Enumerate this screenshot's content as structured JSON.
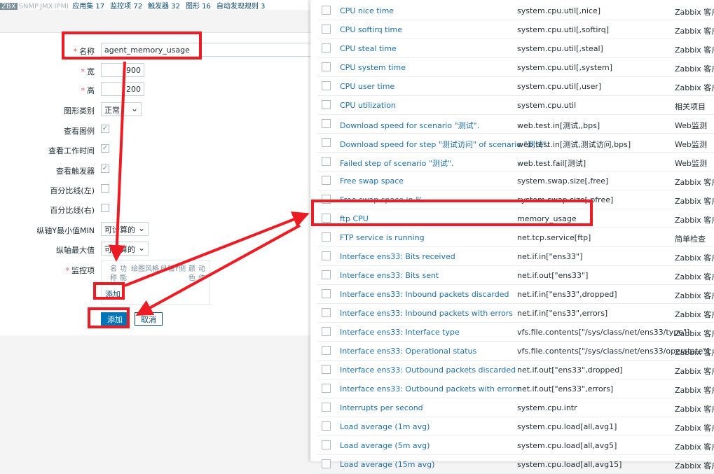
{
  "topbar": {
    "tags": [
      "ZBX",
      "SNMP",
      "JMX",
      "IPMI"
    ],
    "links": [
      "应用集 17",
      "监控项 72",
      "触发器 32",
      "图形 16",
      "自动发现规则 3"
    ]
  },
  "form": {
    "name": {
      "label": "名称",
      "value": "agent_memory_usage"
    },
    "width": {
      "label": "宽",
      "value": "900"
    },
    "height": {
      "label": "高",
      "value": "200"
    },
    "graph_type": {
      "label": "图形类别",
      "value": "正常"
    },
    "show_legend": {
      "label": "查看图例"
    },
    "show_working_time": {
      "label": "查看工作时间"
    },
    "show_triggers": {
      "label": "查看触发器"
    },
    "percentile_left": {
      "label": "百分比线(左)"
    },
    "percentile_right": {
      "label": "百分比线(右)"
    },
    "ymin": {
      "label": "纵轴Y最小值MIN",
      "value": "可计算的"
    },
    "ymax": {
      "label": "纵轴最大值",
      "value": "可计算的"
    },
    "items": {
      "label": "监控项",
      "columns": [
        "名称",
        "功能",
        "绘图风格",
        "纵轴Y侧",
        "颜色",
        "动作"
      ],
      "add_link": "添加"
    },
    "buttons": {
      "add": "添加",
      "cancel": "取消"
    }
  },
  "popup": {
    "rows": [
      {
        "name": "CPU nice time",
        "key": "system.cpu.util[,nice]",
        "type": "Zabbix 客户端"
      },
      {
        "name": "CPU softirq time",
        "key": "system.cpu.util[,softirq]",
        "type": "Zabbix 客户端"
      },
      {
        "name": "CPU steal time",
        "key": "system.cpu.util[,steal]",
        "type": "Zabbix 客户端"
      },
      {
        "name": "CPU system time",
        "key": "system.cpu.util[,system]",
        "type": "Zabbix 客户端"
      },
      {
        "name": "CPU user time",
        "key": "system.cpu.util[,user]",
        "type": "Zabbix 客户端"
      },
      {
        "name": "CPU utilization",
        "key": "system.cpu.util",
        "type": "相关项目"
      },
      {
        "name": "Download speed for scenario \"测试\".",
        "key": "web.test.in[测试,,bps]",
        "type": "Web监测"
      },
      {
        "name": "Download speed for step \"测试访问\" of scenario \"测试\".",
        "key": "web.test.in[测试,测试访问,bps]",
        "type": "Web监测"
      },
      {
        "name": "Failed step of scenario \"测试\".",
        "key": "web.test.fail[测试]",
        "type": "Web监测"
      },
      {
        "name": "Free swap space",
        "key": "system.swap.size[,free]",
        "type": "Zabbix 客户端"
      },
      {
        "name": "Free swap space in %",
        "key": "system.swap.size[,pfree]",
        "type": "Zabbix 客户端"
      },
      {
        "name": "ftp CPU",
        "key": "memory_usage",
        "type": "Zabbix 客户端"
      },
      {
        "name": "FTP service is running",
        "key": "net.tcp.service[ftp]",
        "type": "简单检查"
      },
      {
        "name": "Interface ens33: Bits received",
        "key": "net.if.in[\"ens33\"]",
        "type": "Zabbix 客户端"
      },
      {
        "name": "Interface ens33: Bits sent",
        "key": "net.if.out[\"ens33\"]",
        "type": "Zabbix 客户端"
      },
      {
        "name": "Interface ens33: Inbound packets discarded",
        "key": "net.if.in[\"ens33\",dropped]",
        "type": "Zabbix 客户端"
      },
      {
        "name": "Interface ens33: Inbound packets with errors",
        "key": "net.if.in[\"ens33\",errors]",
        "type": "Zabbix 客户端"
      },
      {
        "name": "Interface ens33: Interface type",
        "key": "vfs.file.contents[\"/sys/class/net/ens33/type\"]",
        "type": "Zabbix 客户端"
      },
      {
        "name": "Interface ens33: Operational status",
        "key": "vfs.file.contents[\"/sys/class/net/ens33/operstate\"]",
        "type": "Zabbix 客户端"
      },
      {
        "name": "Interface ens33: Outbound packets discarded",
        "key": "net.if.out[\"ens33\",dropped]",
        "type": "Zabbix 客户端"
      },
      {
        "name": "Interface ens33: Outbound packets with errors",
        "key": "net.if.out[\"ens33\",errors]",
        "type": "Zabbix 客户端"
      },
      {
        "name": "Interrupts per second",
        "key": "system.cpu.intr",
        "type": "Zabbix 客户端"
      },
      {
        "name": "Load average (1m avg)",
        "key": "system.cpu.load[all,avg1]",
        "type": "Zabbix 客户端"
      },
      {
        "name": "Load average (5m avg)",
        "key": "system.cpu.load[all,avg5]",
        "type": "Zabbix 客户端"
      },
      {
        "name": "Load average (15m avg)",
        "key": "system.cpu.load[all,avg15]",
        "type": "Zabbix 客户端"
      }
    ]
  },
  "colors": {
    "annotation": "#ec1c24",
    "link": "#1f6ea5",
    "primary_button": "#0275b8"
  }
}
